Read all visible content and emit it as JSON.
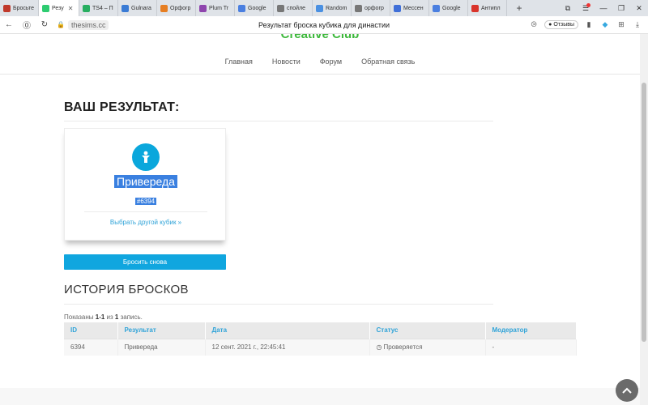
{
  "browser": {
    "tabs": [
      {
        "label": "Бросьте",
        "color": "#c0392b",
        "active": false
      },
      {
        "label": "Резу",
        "color": "#2ecc71",
        "active": true
      },
      {
        "label": "TS4 – П",
        "color": "#27ae60",
        "active": false
      },
      {
        "label": "Gulnara",
        "color": "#3a7bd5",
        "active": false
      },
      {
        "label": "Орфогр",
        "color": "#e67e22",
        "active": false
      },
      {
        "label": "Plum Tr",
        "color": "#8e44ad",
        "active": false
      },
      {
        "label": "Google",
        "color": "#4a7fe0",
        "active": false
      },
      {
        "label": "спойле",
        "color": "#777777",
        "active": false
      },
      {
        "label": "Random",
        "color": "#4a90e2",
        "active": false
      },
      {
        "label": "орфогр",
        "color": "#777777",
        "active": false
      },
      {
        "label": "Мессен",
        "color": "#3f6fd8",
        "active": false
      },
      {
        "label": "Google",
        "color": "#4a7fe0",
        "active": false
      },
      {
        "label": "Антипл",
        "color": "#d9342b",
        "active": false
      }
    ],
    "url": "thesims.cc",
    "page_title": "Результат броска кубика для династии",
    "feedback_label": "Отзывы"
  },
  "site": {
    "brand": "Creative Club",
    "menu": [
      "Главная",
      "Новости",
      "Форум",
      "Обратная связь"
    ]
  },
  "result": {
    "heading": "ВАШ РЕЗУЛЬТАТ:",
    "name": "Привереда",
    "id": "#6394",
    "change_link": "Выбрать другой кубик »",
    "roll_again": "Бросить снова"
  },
  "history": {
    "heading": "ИСТОРИЯ БРОСКОВ",
    "summary_prefix": "Показаны ",
    "summary_range": "1-1",
    "summary_mid": " из ",
    "summary_total": "1",
    "summary_suffix": " запись.",
    "columns": [
      "ID",
      "Результат",
      "Дата",
      "Статус",
      "Модератор"
    ],
    "rows": [
      {
        "id": "6394",
        "result": "Привереда",
        "date": "12 сент. 2021 г., 22:45:41",
        "status": "Проверяется",
        "moderator": "-"
      }
    ]
  }
}
